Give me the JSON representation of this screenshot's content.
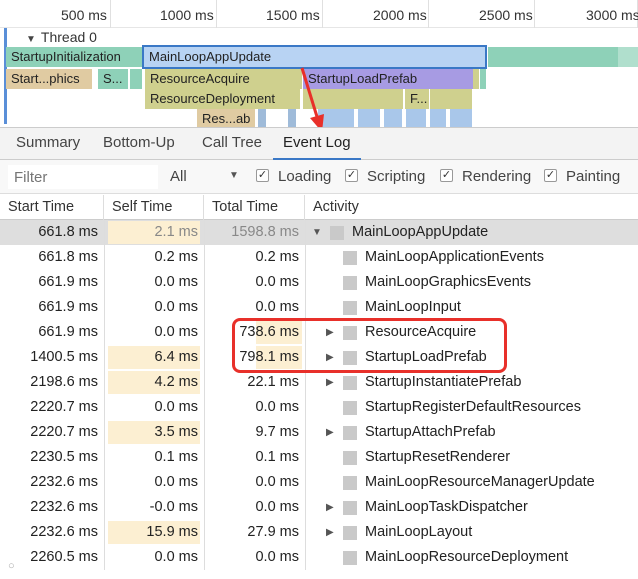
{
  "timeline": {
    "ruler_ticks": [
      "500 ms",
      "1000 ms",
      "1500 ms",
      "2000 ms",
      "2500 ms",
      "3000 ms"
    ],
    "thread_label": "Thread 0",
    "blocks": {
      "startup_init": "StartupInitialization",
      "main_loop_update": "MainLoopAppUpdate",
      "start_phics": "Start...phics",
      "s_short": "S...",
      "resource_acquire": "ResourceAcquire",
      "startup_load_prefab": "StartupLoadPrefab",
      "resource_deployment": "ResourceDeployment",
      "f_short": "F...",
      "res_ab": "Res...ab"
    }
  },
  "tabs": [
    {
      "label": "Summary",
      "active": false
    },
    {
      "label": "Bottom-Up",
      "active": false
    },
    {
      "label": "Call Tree",
      "active": false
    },
    {
      "label": "Event Log",
      "active": true
    }
  ],
  "filter": {
    "placeholder": "Filter",
    "select_value": "All",
    "checkboxes": [
      {
        "label": "Loading",
        "checked": true
      },
      {
        "label": "Scripting",
        "checked": true
      },
      {
        "label": "Rendering",
        "checked": true
      },
      {
        "label": "Painting",
        "checked": true
      }
    ]
  },
  "table": {
    "headers": [
      "Start Time",
      "Self Time",
      "Total Time",
      "Activity"
    ],
    "rows": [
      {
        "start": "661.8 ms",
        "self": "2.1 ms",
        "total": "1598.8 ms",
        "activity": "MainLoopAppUpdate",
        "expander": "down",
        "selected": true
      },
      {
        "start": "661.8 ms",
        "self": "0.2 ms",
        "total": "0.2 ms",
        "activity": "MainLoopApplicationEvents",
        "expander": "none"
      },
      {
        "start": "661.9 ms",
        "self": "0.0 ms",
        "total": "0.0 ms",
        "activity": "MainLoopGraphicsEvents",
        "expander": "none"
      },
      {
        "start": "661.9 ms",
        "self": "0.0 ms",
        "total": "0.0 ms",
        "activity": "MainLoopInput",
        "expander": "none"
      },
      {
        "start": "661.9 ms",
        "self": "0.0 ms",
        "total": "738.6 ms",
        "activity": "ResourceAcquire",
        "expander": "right"
      },
      {
        "start": "1400.5 ms",
        "self": "6.4 ms",
        "total": "798.1 ms",
        "activity": "StartupLoadPrefab",
        "expander": "right"
      },
      {
        "start": "2198.6 ms",
        "self": "4.2 ms",
        "total": "22.1 ms",
        "activity": "StartupInstantiatePrefab",
        "expander": "right"
      },
      {
        "start": "2220.7 ms",
        "self": "0.0 ms",
        "total": "0.0 ms",
        "activity": "StartupRegisterDefaultResources",
        "expander": "none"
      },
      {
        "start": "2220.7 ms",
        "self": "3.5 ms",
        "total": "9.7 ms",
        "activity": "StartupAttachPrefab",
        "expander": "right"
      },
      {
        "start": "2230.5 ms",
        "self": "0.1 ms",
        "total": "0.1 ms",
        "activity": "StartupResetRenderer",
        "expander": "none"
      },
      {
        "start": "2232.6 ms",
        "self": "0.0 ms",
        "total": "0.0 ms",
        "activity": "MainLoopResourceManagerUpdate",
        "expander": "none"
      },
      {
        "start": "2232.6 ms",
        "self": "-0.0 ms",
        "total": "0.0 ms",
        "activity": "MainLoopTaskDispatcher",
        "expander": "right"
      },
      {
        "start": "2232.6 ms",
        "self": "15.9 ms",
        "total": "27.9 ms",
        "activity": "MainLoopLayout",
        "expander": "right"
      },
      {
        "start": "2260.5 ms",
        "self": "0.0 ms",
        "total": "0.0 ms",
        "activity": "MainLoopResourceDeployment",
        "expander": "none"
      }
    ]
  },
  "colors": {
    "accent": "#3a78c6",
    "highlight_box": "#e8302a",
    "self_time_bar": "#fcefd2",
    "selected_row": "#dedede"
  }
}
